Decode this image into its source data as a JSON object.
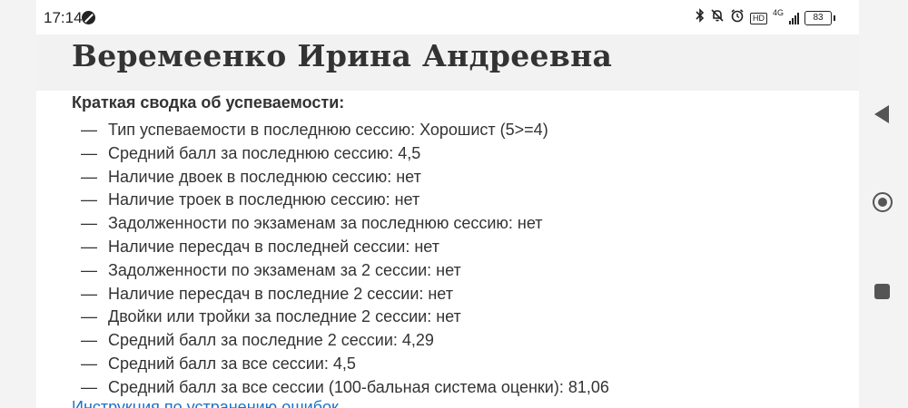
{
  "status_bar": {
    "time": "17:14",
    "network": "4G",
    "battery": "83",
    "icons": [
      "do-not-disturb-icon",
      "bluetooth-icon",
      "muted-bell-icon",
      "alarm-icon",
      "volte-icon",
      "signal-icon",
      "battery-icon"
    ]
  },
  "page": {
    "title": "Веремеенко Ирина Андреевна",
    "section_label": "Краткая сводка об успеваемости:",
    "bullet": "—",
    "items": [
      "Тип успеваемости в последнюю сессию: Хорошист (5>=4)",
      "Средний балл за последнюю сессию: 4,5",
      "Наличие двоек в последнюю сессию: нет",
      "Наличие троек в последнюю сессию: нет",
      "Задолженности по экзаменам за последнюю сессию: нет",
      "Наличие пересдач в последней сессии: нет",
      "Задолженности по экзаменам за 2 сессии: нет",
      "Наличие пересдач в последние 2 сессии: нет",
      "Двойки или тройки за последние 2 сессии: нет",
      "Средний балл за последние 2 сессии: 4,29",
      "Средний балл за все сессии: 4,5",
      "Средний балл за все сессии (100-бальная система оценки): 81,06"
    ],
    "link": "Инструкция по устранению ошибок"
  },
  "nav": {
    "icons": [
      "back-icon",
      "home-icon",
      "recents-icon"
    ]
  }
}
